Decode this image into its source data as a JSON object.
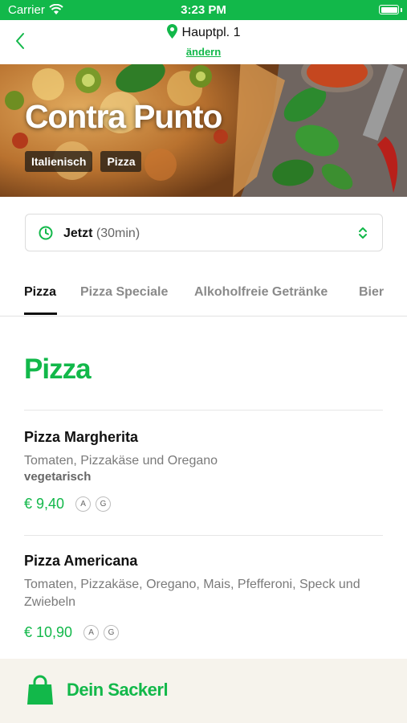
{
  "status_bar": {
    "carrier": "Carrier",
    "time": "3:23 PM"
  },
  "nav": {
    "location": "Hauptpl. 1",
    "change_label": "ändern"
  },
  "restaurant": {
    "name": "Contra Punto",
    "tags": [
      "Italienisch",
      "Pizza"
    ]
  },
  "time_selector": {
    "label": "Jetzt",
    "detail": "(30min)"
  },
  "tabs": [
    {
      "label": "Pizza",
      "active": true
    },
    {
      "label": "Pizza Speciale",
      "active": false
    },
    {
      "label": "Alkoholfreie Getränke",
      "active": false
    },
    {
      "label": "Bier",
      "active": false
    }
  ],
  "menu": {
    "section_title": "Pizza",
    "items": [
      {
        "name": "Pizza Margherita",
        "description": "Tomaten, Pizzakäse und Oregano",
        "note": "vegetarisch",
        "price": "€ 9,40",
        "allergens": [
          "A",
          "G"
        ]
      },
      {
        "name": "Pizza Americana",
        "description": "Tomaten, Pizzakäse, Oregano, Mais, Pfefferoni, Speck und Zwiebeln",
        "price": "€ 10,90",
        "allergens": [
          "A",
          "G"
        ]
      }
    ]
  },
  "cart": {
    "label": "Dein Sackerl"
  },
  "colors": {
    "brand": "#12b84a",
    "cart_bg": "#f6f3ec"
  },
  "icons": [
    "wifi-icon",
    "battery-icon",
    "back-chevron-icon",
    "location-pin-icon",
    "clock-icon",
    "chevron-updown-icon",
    "shopping-bag-icon"
  ]
}
